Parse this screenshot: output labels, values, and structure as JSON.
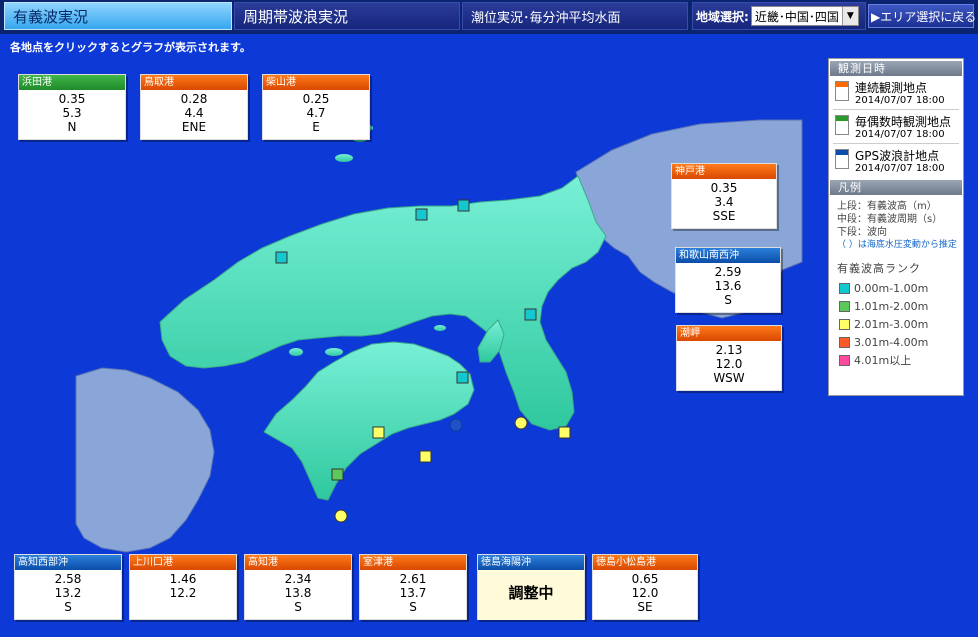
{
  "tabs": [
    {
      "label": "有義波実況",
      "active": true
    },
    {
      "label": "周期帯波浪実況",
      "active": false
    },
    {
      "label": "潮位実況･毎分沖平均水面",
      "active": false
    }
  ],
  "region": {
    "label": "地域選択:",
    "selected": "近畿･中国･四国"
  },
  "back_button": "▶エリア選択に戻る",
  "instruction": "各地点をクリックするとグラフが表示されます。",
  "stations": [
    {
      "name": "浜田港",
      "type": "green",
      "height": "0.35",
      "period": "5.3",
      "direction": "N"
    },
    {
      "name": "鳥取港",
      "type": "orange",
      "height": "0.28",
      "period": "4.4",
      "direction": "ENE"
    },
    {
      "name": "柴山港",
      "type": "orange",
      "height": "0.25",
      "period": "4.7",
      "direction": "E"
    },
    {
      "name": "神戸港",
      "type": "orange",
      "height": "0.35",
      "period": "3.4",
      "direction": "SSE"
    },
    {
      "name": "和歌山南西沖",
      "type": "blue",
      "height": "2.59",
      "period": "13.6",
      "direction": "S"
    },
    {
      "name": "潮岬",
      "type": "orange",
      "height": "2.13",
      "period": "12.0",
      "direction": "WSW"
    },
    {
      "name": "高知西部沖",
      "type": "blue",
      "height": "2.58",
      "period": "13.2",
      "direction": "S"
    },
    {
      "name": "上川口港",
      "type": "orange",
      "height": "1.46",
      "period": "12.2",
      "direction": ""
    },
    {
      "name": "高知港",
      "type": "orange",
      "height": "2.34",
      "period": "13.8",
      "direction": "S"
    },
    {
      "name": "室津港",
      "type": "orange",
      "height": "2.61",
      "period": "13.7",
      "direction": "S"
    },
    {
      "name": "徳島海陽沖",
      "type": "blue",
      "status": "調整中"
    },
    {
      "name": "徳島小松島港",
      "type": "orange",
      "height": "0.65",
      "period": "12.0",
      "direction": "SE"
    }
  ],
  "legend": {
    "obs_title": "観測日時",
    "items": [
      {
        "label": "連続観測地点",
        "time": "2014/07/07 18:00",
        "color": "#ff6a00"
      },
      {
        "label": "毎偶数時観測地点",
        "time": "2014/07/07 18:00",
        "color": "#2a9a2a"
      },
      {
        "label": "GPS波浪計地点",
        "time": "2014/07/07 18:00",
        "color": "#0b4da8"
      }
    ],
    "hanrei_title": "凡例",
    "notes": [
      "上段：有義波高（m）",
      "中段：有義波周期（s）",
      "下段：波向"
    ],
    "note_blue": "（ ）は海底水圧変動から推定",
    "rank_title": "有義波高ランク",
    "ranks": [
      {
        "label": "0.00m-1.00m",
        "color": "#14c8d0"
      },
      {
        "label": "1.01m-2.00m",
        "color": "#5cc85a"
      },
      {
        "label": "2.01m-3.00m",
        "color": "#ffff66"
      },
      {
        "label": "3.01m-4.00m",
        "color": "#ff5a2a"
      },
      {
        "label": "4.01m以上",
        "color": "#ff4aa0"
      }
    ]
  },
  "colors": {
    "sea": "#0d3ad6",
    "land_main": "#66e6c8",
    "land_other": "#8aa6d8"
  }
}
